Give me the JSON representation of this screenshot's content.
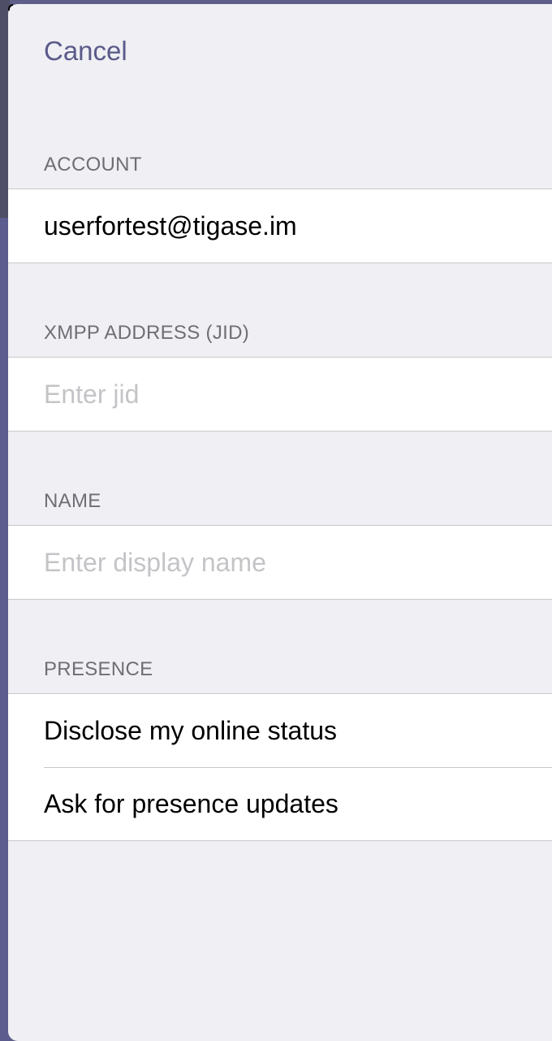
{
  "nav": {
    "cancel_label": "Cancel"
  },
  "sections": {
    "account": {
      "header": "ACCOUNT",
      "value": "userfortest@tigase.im"
    },
    "jid": {
      "header": "XMPP ADDRESS (JID)",
      "value": "",
      "placeholder": "Enter jid"
    },
    "name": {
      "header": "NAME",
      "value": "",
      "placeholder": "Enter display name"
    },
    "presence": {
      "header": "PRESENCE",
      "items": [
        {
          "label": "Disclose my online status"
        },
        {
          "label": "Ask for presence updates"
        }
      ]
    }
  },
  "colors": {
    "accent": "#5a5a8a",
    "background": "#efeff4",
    "cell_background": "#ffffff",
    "header_text": "#6e6e74",
    "placeholder": "#c4c4c8",
    "separator": "#c8c8cc"
  }
}
